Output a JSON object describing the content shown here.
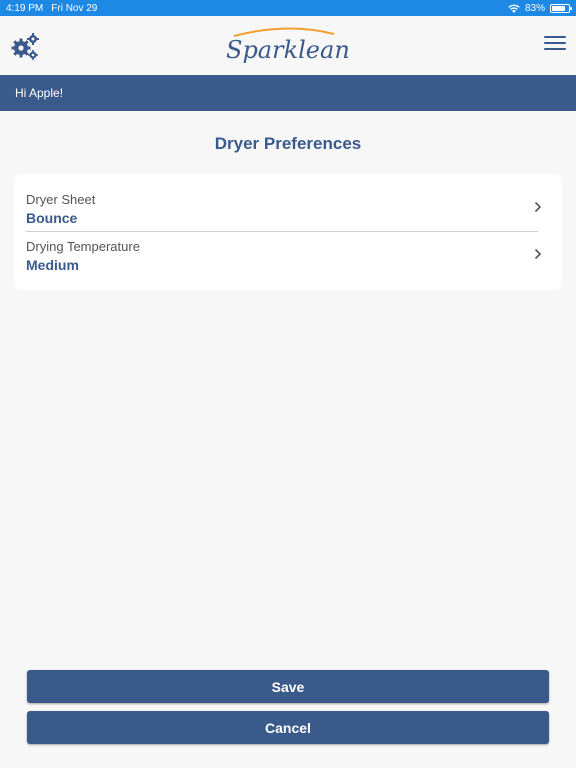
{
  "status_bar": {
    "time": "4:19 PM",
    "date": "Fri Nov 29",
    "battery": "83%",
    "battery_level": 0.83,
    "wifi_icon": "wifi-icon",
    "battery_icon": "battery-icon",
    "color": "#1e88e5"
  },
  "header": {
    "logo_text": "Sparklean",
    "settings_icon": "gears-icon",
    "menu_icon": "hamburger-menu-icon"
  },
  "greeting": "Hi Apple!",
  "page": {
    "title": "Dryer Preferences"
  },
  "preferences": [
    {
      "label": "Dryer Sheet",
      "value": "Bounce",
      "icon": "chevron-right-icon"
    },
    {
      "label": "Drying Temperature",
      "value": "Medium",
      "icon": "chevron-right-icon"
    }
  ],
  "buttons": {
    "save_label": "Save",
    "cancel_label": "Cancel"
  },
  "colors": {
    "brand_blue": "#3a5a8c",
    "logo_orange": "#f0a030",
    "background": "#f7f7f7"
  }
}
